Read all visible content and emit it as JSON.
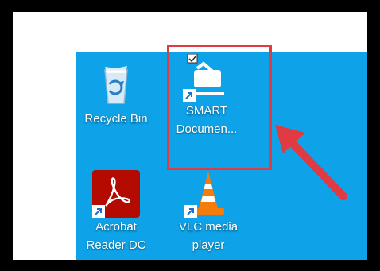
{
  "desktop": {
    "icons": [
      {
        "label1": "Recycle Bin",
        "label2": "",
        "icon": "recycle-bin-icon"
      },
      {
        "label1": "SMART",
        "label2": "Documen...",
        "icon": "smart-document-camera-icon"
      },
      {
        "label1": "Acrobat",
        "label2": "Reader DC",
        "icon": "acrobat-reader-icon"
      },
      {
        "label1": "VLC media",
        "label2": "player",
        "icon": "vlc-player-icon"
      }
    ]
  },
  "annotation": {
    "highlight_color": "#e03a43",
    "arrow_color": "#e03a43"
  }
}
